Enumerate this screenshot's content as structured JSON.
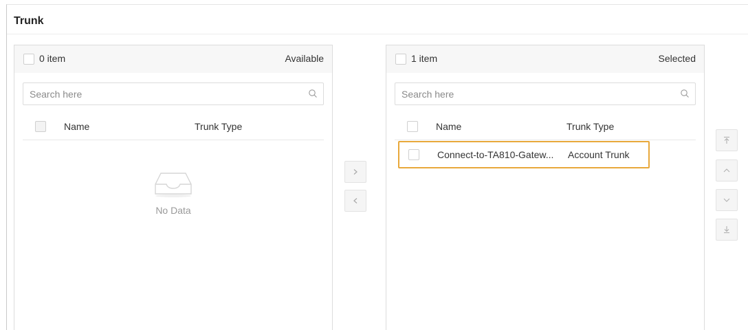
{
  "section": {
    "title": "Trunk"
  },
  "available": {
    "count": "0 item",
    "label": "Available",
    "search_placeholder": "Search here",
    "columns": {
      "name": "Name",
      "type": "Trunk Type"
    },
    "empty_text": "No Data"
  },
  "selected": {
    "count": "1 item",
    "label": "Selected",
    "search_placeholder": "Search here",
    "columns": {
      "name": "Name",
      "type": "Trunk Type"
    },
    "rows": [
      {
        "name": "Connect-to-TA810-Gatew...",
        "type": "Account Trunk"
      }
    ]
  },
  "transfer_buttons": {
    "move_right_icon": "chevron-right-icon",
    "move_left_icon": "chevron-left-icon"
  },
  "order_buttons": {
    "icons": [
      "move-top-icon",
      "move-up-icon",
      "move-down-icon",
      "move-bottom-icon"
    ]
  },
  "colors": {
    "highlight": "#e8a83a",
    "header_bg": "#f7f7f7",
    "button_bg": "#f5f5f5"
  }
}
